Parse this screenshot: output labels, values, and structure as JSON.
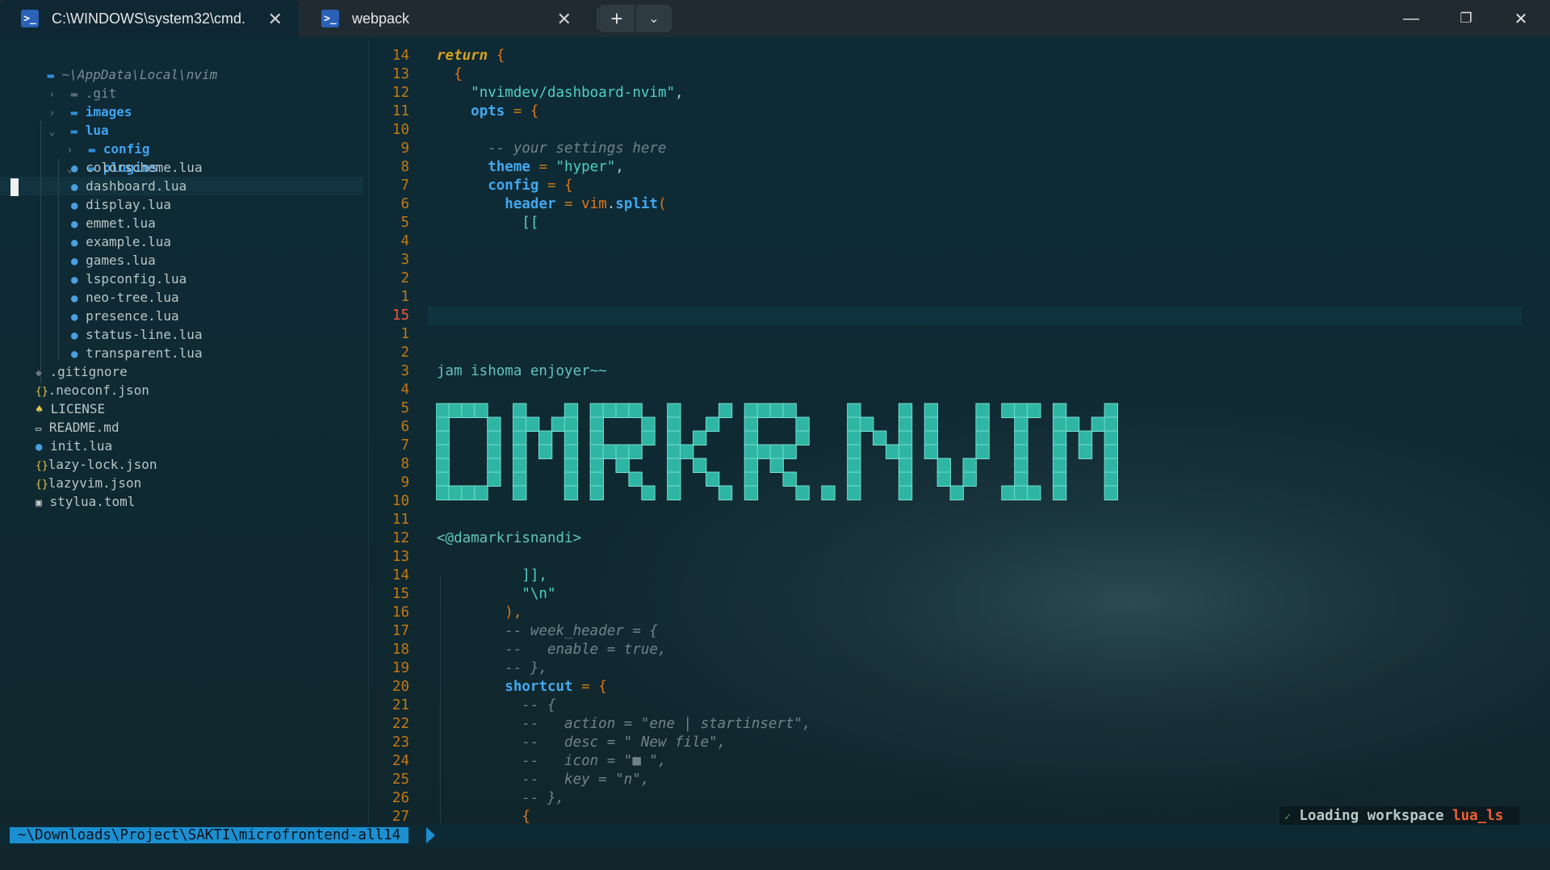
{
  "tabs": [
    {
      "title": "C:\\WINDOWS\\system32\\cmd.",
      "active": true
    },
    {
      "title": "webpack",
      "active": false
    }
  ],
  "tree": {
    "root": "~\\AppData\\Local\\nvim",
    "items": [
      {
        "name": ".git",
        "kind": "git-dir",
        "icon": "folder-icon"
      },
      {
        "name": "images",
        "kind": "dir",
        "icon": "folder-icon"
      },
      {
        "name": "lua",
        "kind": "dir-open",
        "icon": "folder-open-icon"
      },
      {
        "name": "config",
        "kind": "dir",
        "icon": "folder-icon"
      },
      {
        "name": "plugins",
        "kind": "dir-open",
        "icon": "folder-open-icon"
      },
      {
        "name": "colorscheme.lua",
        "kind": "lua"
      },
      {
        "name": "dashboard.lua",
        "kind": "lua",
        "selected": true
      },
      {
        "name": "display.lua",
        "kind": "lua"
      },
      {
        "name": "emmet.lua",
        "kind": "lua"
      },
      {
        "name": "example.lua",
        "kind": "lua"
      },
      {
        "name": "games.lua",
        "kind": "lua"
      },
      {
        "name": "lspconfig.lua",
        "kind": "lua"
      },
      {
        "name": "neo-tree.lua",
        "kind": "lua"
      },
      {
        "name": "presence.lua",
        "kind": "lua"
      },
      {
        "name": "status-line.lua",
        "kind": "lua"
      },
      {
        "name": "transparent.lua",
        "kind": "lua"
      },
      {
        "name": ".gitignore",
        "kind": "gitignore"
      },
      {
        "name": ".neoconf.json",
        "kind": "json"
      },
      {
        "name": "LICENSE",
        "kind": "license"
      },
      {
        "name": "README.md",
        "kind": "md"
      },
      {
        "name": "init.lua",
        "kind": "lua"
      },
      {
        "name": "lazy-lock.json",
        "kind": "json"
      },
      {
        "name": "lazyvim.json",
        "kind": "json"
      },
      {
        "name": "stylua.toml",
        "kind": "toml"
      }
    ]
  },
  "gutter": [
    "14",
    "13",
    "12",
    "11",
    "10",
    "9",
    "8",
    "7",
    "6",
    "5",
    "4",
    "3",
    "2",
    "1",
    "15",
    "1",
    "2",
    "3",
    "4",
    "5",
    "6",
    "7",
    "8",
    "9",
    "10",
    "11",
    "12",
    "13",
    "14",
    "15",
    "16",
    "17",
    "18",
    "19",
    "20",
    "21",
    "22",
    "23",
    "24",
    "25",
    "26",
    "27"
  ],
  "code": {
    "l0_return": "return",
    "l0_brace": "{",
    "l1_brace": "{",
    "l2_str": "\"nvimdev/dashboard-nvim\"",
    "l2_comma": ",",
    "l3_opts": "opts",
    "l3_eq": " = ",
    "l3_brace": "{",
    "l5_comment": "-- your settings here",
    "l6_theme": "theme",
    "l6_eq": " = ",
    "l6_val": "\"hyper\"",
    "l6_comma": ",",
    "l7_config": "config",
    "l7_eq": " = ",
    "l7_brace": "{",
    "l8_header": "header",
    "l8_eq": " = ",
    "l8_fn": "vim",
    "l8_dot": ".",
    "l8_split": "split",
    "l8_paren": "(",
    "l9_open": "[[",
    "tagline": "jam ishoma enjoyer~~",
    "banner_text": "DMRKR.NVIM",
    "handle": "<@damarkrisnandi>",
    "l30_close": "]],",
    "l31_nl": "\"\\n\"",
    "l32_paren": "),",
    "l33": "-- week_header = {",
    "l34": "--   enable = true,",
    "l35": "-- },",
    "l36_shortcut": "shortcut",
    "l36_eq": " = ",
    "l36_brace": "{",
    "l37": "-- {",
    "l38": "--   action = \"ene | startinsert\",",
    "l39": "--   desc = \" New file\",",
    "l40": "--   icon = \"■ \",",
    "l41": "--   key = \"n\",",
    "l42": "-- },",
    "l43": "{"
  },
  "status": {
    "cwd": "~\\Downloads\\Project\\SAKTI\\microfrontend-all14",
    "lsp_check": "✓",
    "lsp_msg": "Loading workspace ",
    "lsp_server": "lua_ls"
  }
}
